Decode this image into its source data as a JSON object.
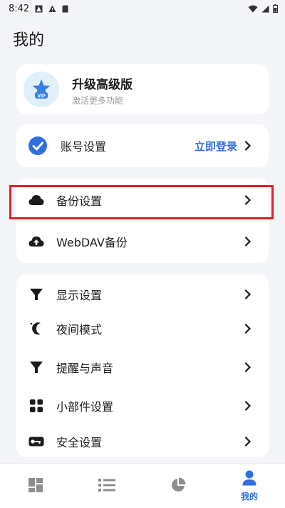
{
  "status_bar": {
    "time": "8:42"
  },
  "header": {
    "title": "我的"
  },
  "vip": {
    "title": "升级高级版",
    "subtitle": "激活更多功能",
    "badge_text": "VIP"
  },
  "account": {
    "label": "账号设置",
    "action": "立即登录"
  },
  "backup": {
    "items": [
      {
        "label": "备份设置",
        "icon": "cloud-icon"
      },
      {
        "label": "WebDAV备份",
        "icon": "cloud-upload-icon"
      }
    ]
  },
  "settings": {
    "items": [
      {
        "label": "显示设置",
        "icon": "funnel-icon"
      },
      {
        "label": "夜间模式",
        "icon": "moon-icon"
      },
      {
        "label": "提醒与声音",
        "icon": "funnel-icon"
      },
      {
        "label": "小部件设置",
        "icon": "widgets-icon"
      },
      {
        "label": "安全设置",
        "icon": "key-icon"
      }
    ]
  },
  "bottom_nav": {
    "items": [
      {
        "icon": "dashboard-icon",
        "label": ""
      },
      {
        "icon": "list-icon",
        "label": ""
      },
      {
        "icon": "pie-chart-icon",
        "label": ""
      },
      {
        "icon": "person-icon",
        "label": "我的",
        "active": true
      }
    ]
  },
  "colors": {
    "accent": "#2f6fe0",
    "highlight": "#e0202b",
    "background": "#f4f5f9"
  }
}
